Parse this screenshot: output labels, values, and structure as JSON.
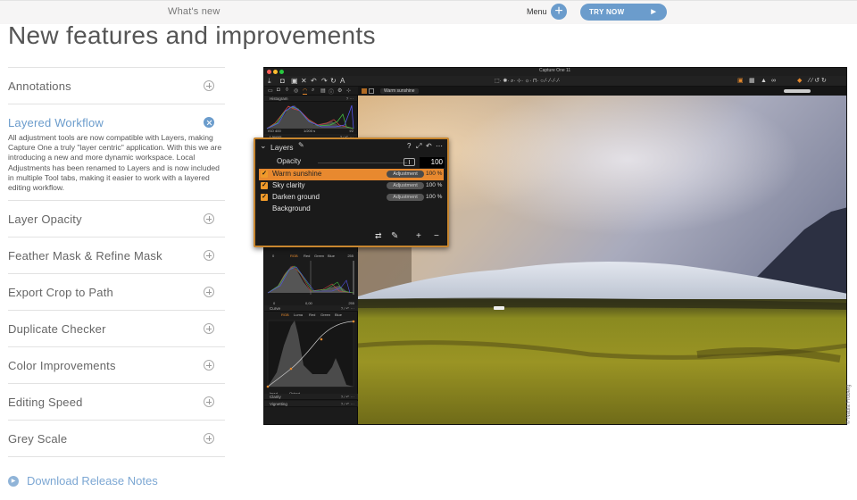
{
  "topbar": {
    "section_label": "What's new",
    "menu_label": "Menu",
    "menu_icon": "plus-icon",
    "try_now_label": "TRY NOW",
    "try_now_icon": "play-arrow-icon",
    "accent_color": "#6b9ccc"
  },
  "page": {
    "title": "New features and improvements"
  },
  "accordion": {
    "items": [
      {
        "title": "Annotations",
        "state": "collapsed",
        "icon": "plus-circle-icon"
      },
      {
        "title": "Layered Workflow",
        "state": "expanded",
        "icon": "close-circle-icon",
        "body": "All adjustment tools are now compatible with Layers, making Capture One a truly \"layer centric\" application. With this we are introducing a new and more dynamic workspace. Local Adjustments has been renamed to Layers and is now included in multiple Tool tabs, making it easier to work with a layered editing workflow."
      },
      {
        "title": "Layer Opacity",
        "state": "collapsed",
        "icon": "plus-circle-icon"
      },
      {
        "title": "Feather Mask & Refine Mask",
        "state": "collapsed",
        "icon": "plus-circle-icon"
      },
      {
        "title": "Export Crop to Path",
        "state": "collapsed",
        "icon": "plus-circle-icon"
      },
      {
        "title": "Duplicate Checker",
        "state": "collapsed",
        "icon": "plus-circle-icon"
      },
      {
        "title": "Color Improvements",
        "state": "collapsed",
        "icon": "plus-circle-icon"
      },
      {
        "title": "Editing Speed",
        "state": "collapsed",
        "icon": "plus-circle-icon"
      },
      {
        "title": "Grey Scale",
        "state": "collapsed",
        "icon": "plus-circle-icon"
      }
    ],
    "download_label": "Download Release Notes"
  },
  "app": {
    "window_title": "Capture One 11",
    "variant_name": "Warm sunshine",
    "histogram": {
      "title": "Histogram",
      "iso": "ISO 400",
      "shutter": "1/200 s",
      "aperture": "f/2"
    },
    "levels": {
      "channels": [
        "RGB",
        "Red",
        "Green",
        "Blue"
      ],
      "active_channel": "RGB",
      "black_input": "0",
      "white_input": "255",
      "black_output": "0",
      "midtone": "0,00",
      "white_output": "255"
    },
    "curve": {
      "title": "Curve",
      "channels": [
        "RGB",
        "Luma",
        "Red",
        "Green",
        "Blue"
      ],
      "active_channel": "RGB",
      "input_label": "Input",
      "output_label": "Output"
    },
    "collapsed_tools": [
      "Clarity",
      "Vignetting"
    ],
    "layers_small_title": "Layers"
  },
  "layers_panel": {
    "title": "Layers",
    "opacity_label": "Opacity",
    "opacity_value": "100",
    "rows": [
      {
        "name": "Warm sunshine",
        "type": "Adjustment",
        "opacity": "100 %",
        "checked": true,
        "selected": true
      },
      {
        "name": "Sky clarity",
        "type": "Adjustment",
        "opacity": "100 %",
        "checked": true,
        "selected": false
      },
      {
        "name": "Darken ground",
        "type": "Adjustment",
        "opacity": "100 %",
        "checked": true,
        "selected": false
      },
      {
        "name": "Background",
        "type": "",
        "opacity": "",
        "checked": false,
        "selected": false
      }
    ],
    "highlight_color": "#e8892f"
  },
  "credit": "© Nadia Froberg"
}
